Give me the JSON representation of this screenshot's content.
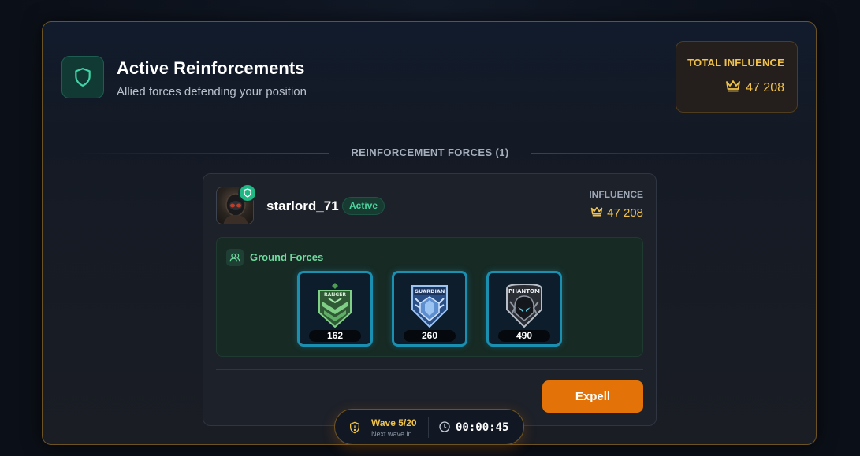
{
  "header": {
    "title": "Active Reinforcements",
    "subtitle": "Allied forces defending your position",
    "icon": "shield-icon",
    "total_influence_label": "TOTAL INFLUENCE",
    "total_influence_value": "47 208"
  },
  "section": {
    "title": "REINFORCEMENT FORCES (1)"
  },
  "reinforcements": [
    {
      "username": "starlord_71",
      "status": "Active",
      "influence_label": "INFLUENCE",
      "influence_value": "47 208",
      "forces": {
        "title": "Ground Forces",
        "units": [
          {
            "name": "RANGER",
            "count": "162"
          },
          {
            "name": "GUARDIAN",
            "count": "260"
          },
          {
            "name": "PHANTOM",
            "count": "490"
          }
        ]
      },
      "action_label": "Expell"
    }
  ],
  "wave": {
    "title": "Wave 5/20",
    "subtitle": "Next wave in",
    "timer": "00:00:45"
  },
  "colors": {
    "accent_gold": "#f0c24b",
    "accent_green": "#1fb885",
    "button_orange": "#e37308",
    "unit_border": "#1a8fb0"
  }
}
